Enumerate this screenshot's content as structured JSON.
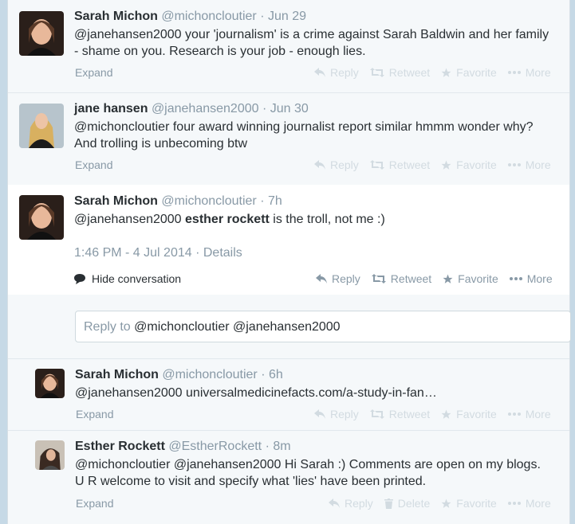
{
  "tweets": [
    {
      "fullname": "Sarah Michon",
      "username": "@michoncloutier",
      "dot": "·",
      "time": "Jun 29",
      "text": "@janehansen2000 your 'journalism' is a crime against Sarah Baldwin and her family - shame on you. Research is your job - enough lies.",
      "expand": "Expand",
      "actions": {
        "reply": "Reply",
        "retweet": "Retweet",
        "favorite": "Favorite",
        "more": "More"
      }
    },
    {
      "fullname": "jane hansen",
      "username": "@janehansen2000",
      "dot": "·",
      "time": "Jun 30",
      "text": "@michoncloutier four award winning journalist report similar hmmm wonder why? And trolling is unbecoming btw",
      "expand": "Expand",
      "actions": {
        "reply": "Reply",
        "retweet": "Retweet",
        "favorite": "Favorite",
        "more": "More"
      }
    },
    {
      "fullname": "Sarah Michon",
      "username": "@michoncloutier",
      "dot": "·",
      "time": "7h",
      "text_prefix": "@janehansen2000 ",
      "text_bold": "esther rockett",
      "text_suffix": " is the troll, not me :)",
      "timestamp": "1:46 PM - 4 Jul 2014",
      "details_sep": "·",
      "details": "Details",
      "hide_conversation": "Hide conversation",
      "actions": {
        "reply": "Reply",
        "retweet": "Retweet",
        "favorite": "Favorite",
        "more": "More"
      }
    },
    {
      "fullname": "Sarah Michon",
      "username": "@michoncloutier",
      "dot": "·",
      "time": "6h",
      "text": "@janehansen2000 universalmedicinefacts.com/a-study-in-fan…",
      "expand": "Expand",
      "actions": {
        "reply": "Reply",
        "retweet": "Retweet",
        "favorite": "Favorite",
        "more": "More"
      }
    },
    {
      "fullname": "Esther Rockett",
      "username": "@EstherRockett",
      "dot": "·",
      "time": "8m",
      "text": "@michoncloutier @janehansen2000 Hi Sarah :) Comments are open on my blogs. U R welcome to visit and specify what 'lies' have been printed.",
      "expand": "Expand",
      "actions": {
        "reply": "Reply",
        "delete": "Delete",
        "favorite": "Favorite",
        "more": "More"
      }
    }
  ],
  "reply_box": {
    "placeholder": "Reply to",
    "mentions": "@michoncloutier @janehansen2000"
  }
}
